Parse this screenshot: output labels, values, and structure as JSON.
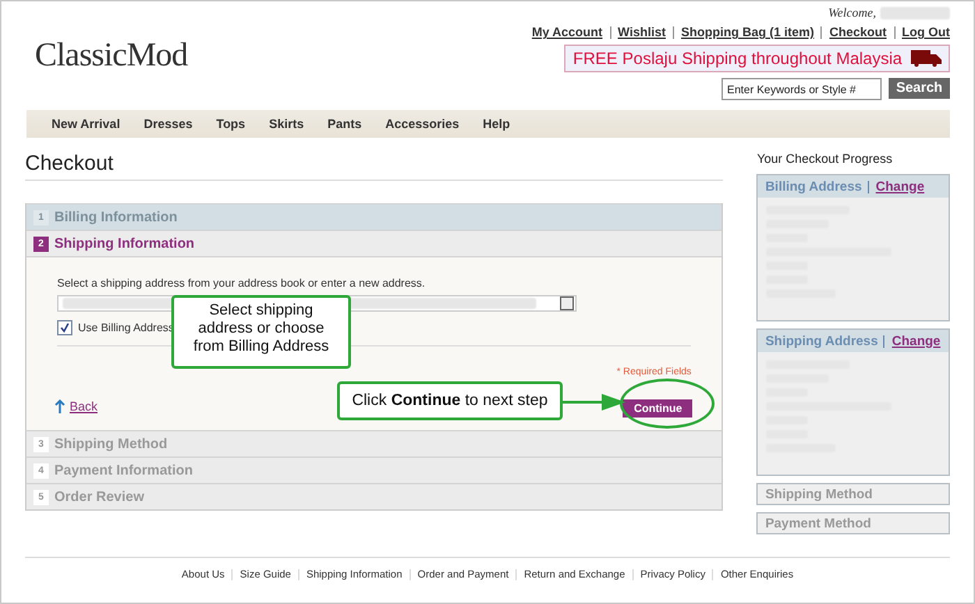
{
  "header": {
    "welcome": "Welcome,",
    "account_links": [
      "My Account",
      "Wishlist",
      "Shopping Bag (1 item)",
      "Checkout",
      "Log Out"
    ],
    "logo": "ClassicMod",
    "promo_banner": "FREE Poslaju Shipping throughout Malaysia",
    "search": {
      "placeholder": "Enter Keywords or Style #",
      "button": "Search"
    }
  },
  "nav": [
    "New Arrival",
    "Dresses",
    "Tops",
    "Skirts",
    "Pants",
    "Accessories",
    "Help"
  ],
  "page_title": "Checkout",
  "steps": [
    {
      "number": "1",
      "title": "Billing Information",
      "completed": true,
      "selected": false
    },
    {
      "number": "2",
      "title": "Shipping Information",
      "completed": false,
      "selected": true
    },
    {
      "number": "3",
      "title": "Shipping Method",
      "completed": false,
      "selected": false
    },
    {
      "number": "4",
      "title": "Payment Information",
      "completed": false,
      "selected": false
    },
    {
      "number": "5",
      "title": "Order Review",
      "completed": false,
      "selected": false
    }
  ],
  "shipping_form": {
    "instruction": "Select a shipping address from your address book or enter a new address.",
    "use_billing_address": {
      "label": "Use Billing Address",
      "checked": true
    },
    "required_note": "* Required Fields",
    "back_link": "Back",
    "continue_button": "Continue"
  },
  "annotations": [
    {
      "kind": "box",
      "text": "Select shipping address or choose from Billing Address"
    },
    {
      "kind": "arrow",
      "text": "Click **Continue** to next step"
    }
  ],
  "progress": {
    "title": "Your Checkout Progress",
    "sections": [
      {
        "kind": "address",
        "title": "Billing Address",
        "change_link": "Change"
      },
      {
        "kind": "address",
        "title": "Shipping Address",
        "change_link": "Change"
      },
      {
        "kind": "plain",
        "title": "Shipping Method"
      },
      {
        "kind": "plain",
        "title": "Payment Method"
      }
    ]
  },
  "footer_links": [
    "About Us",
    "Size Guide",
    "Shipping Information",
    "Order and Payment",
    "Return and Exchange",
    "Privacy Policy",
    "Other Enquiries"
  ]
}
